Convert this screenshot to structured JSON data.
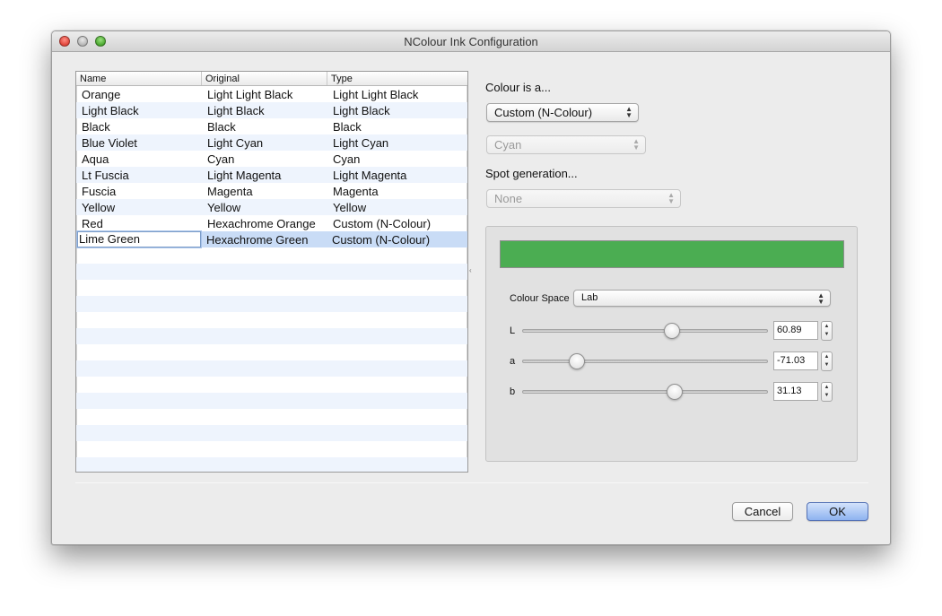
{
  "window": {
    "title": "NColour Ink Configuration"
  },
  "ink_table": {
    "columns": [
      "Name",
      "Original",
      "Type"
    ],
    "rows": [
      {
        "name": "Orange",
        "original": "Light Light Black",
        "type": "Light Light Black"
      },
      {
        "name": "Light Black",
        "original": "Light Black",
        "type": "Light Black"
      },
      {
        "name": "Black",
        "original": "Black",
        "type": "Black"
      },
      {
        "name": "Blue Violet",
        "original": "Light Cyan",
        "type": "Light Cyan"
      },
      {
        "name": "Aqua",
        "original": "Cyan",
        "type": "Cyan"
      },
      {
        "name": "Lt Fuscia",
        "original": "Light Magenta",
        "type": "Light Magenta"
      },
      {
        "name": "Fuscia",
        "original": "Magenta",
        "type": "Magenta"
      },
      {
        "name": "Yellow",
        "original": "Yellow",
        "type": "Yellow"
      },
      {
        "name": "Red",
        "original": "Hexachrome Orange",
        "type": "Custom (N-Colour)"
      },
      {
        "name": "Lime Green",
        "original": "Hexachrome Green",
        "type": "Custom (N-Colour)"
      }
    ],
    "selected_row": 9,
    "editing_row": 9
  },
  "colour_type": {
    "label": "Colour is a...",
    "selected": "Custom (N-Colour)",
    "secondary_selected": "Cyan"
  },
  "spot_generation": {
    "label": "Spot generation...",
    "selected": "None"
  },
  "colour": {
    "swatch_color": "#4bad52",
    "space_label": "Colour Space",
    "space_selected": "Lab",
    "channels": [
      {
        "label": "L",
        "value": "60.89",
        "min": 0,
        "max": 100,
        "level": 60.89
      },
      {
        "label": "a",
        "value": "-71.03",
        "min": -128,
        "max": 128,
        "level": -71.03
      },
      {
        "label": "b",
        "value": "31.13",
        "min": -128,
        "max": 128,
        "level": 31.13
      }
    ]
  },
  "buttons": {
    "cancel": "Cancel",
    "ok": "OK"
  }
}
